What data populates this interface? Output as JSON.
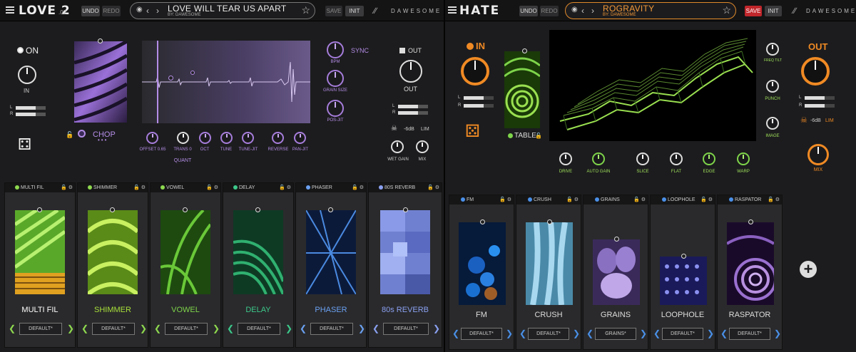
{
  "love": {
    "brand": "LOVE 2",
    "version": ".02",
    "undo": "UNDO",
    "redo": "REDO",
    "preset_name": "LOVE WILL TEAR US APART",
    "preset_by": "BY: DAWESOME",
    "save": "SAVE",
    "init": "INIT",
    "logo": "DAWESOME",
    "on_label": "ON",
    "in_label": "IN",
    "out_label": "OUT",
    "out_toggle": "OUT",
    "meter_l": "L",
    "meter_r": "R",
    "chop": "CHOP",
    "sync": "SYNC",
    "quant": "QUANT",
    "knobs": {
      "bpm": "BPM",
      "grain_size": "GRAIN SIZE",
      "pos_jit": "POS-JIT",
      "offset": "OFFSET 0.65",
      "trans": "TRANS 0",
      "oct": "OCT",
      "tune": "TUNE",
      "tune_jit": "TUNE-JIT",
      "reverse": "REVERSE",
      "pan_jit": "PAN-JIT",
      "wet_gain": "WET GAIN",
      "mix": "MIX"
    },
    "limiter": "-6dB",
    "lim": "LIM",
    "slots": [
      {
        "header": "MULTI FIL",
        "name": "MULTI FIL",
        "preset": "DEFAULT*",
        "color": "#ffffff",
        "arrow_color": "#8ed94f",
        "dot": "#8ed94f"
      },
      {
        "header": "SHIMMER",
        "name": "SHIMMER",
        "preset": "DEFAULT*",
        "color": "#a8e03a",
        "arrow_color": "#8ed94f",
        "dot": "#8ed94f"
      },
      {
        "header": "VOWEL",
        "name": "VOWEL",
        "preset": "DEFAULT*",
        "color": "#7ed44a",
        "arrow_color": "#8ed94f",
        "dot": "#8ed94f"
      },
      {
        "header": "DELAY",
        "name": "DELAY",
        "preset": "DEFAULT*",
        "color": "#3cc88a",
        "arrow_color": "#3cc88a",
        "dot": "#3cc88a"
      },
      {
        "header": "PHASER",
        "name": "PHASER",
        "preset": "DEFAULT*",
        "color": "#6aa0f0",
        "arrow_color": "#6aa0f0",
        "dot": "#6aa0f0"
      },
      {
        "header": "80S REVERB",
        "name": "80s REVERB",
        "preset": "DEFAULT*",
        "color": "#8aa0f0",
        "arrow_color": "#8aa0f0",
        "dot": "#8aa0f0"
      }
    ]
  },
  "hate": {
    "brand": "HATE",
    "undo": "UNDO",
    "redo": "REDO",
    "preset_name": "ROGRAVITY",
    "preset_by": "BY: DAWESOME",
    "save": "SAVE",
    "init": "INIT",
    "logo": "DAWESOME",
    "in_label": "IN",
    "out_label": "OUT",
    "table": "TABLE",
    "meter_l": "L",
    "meter_r": "R",
    "knobs": {
      "freq_tilt": "FREQ TILT",
      "punch": "PUNCH",
      "image": "IMAGE",
      "drive": "DRIVE",
      "auto_gain": "AUTO GAIN",
      "slice": "SLICE",
      "flat": "FLAT",
      "edge": "EDGE",
      "warp": "WARP",
      "mix": "MIX"
    },
    "limiter": "-6dB",
    "lim": "LIM",
    "add": "+",
    "slots": [
      {
        "header": "FM",
        "name": "FM",
        "preset": "DEFAULT*"
      },
      {
        "header": "CRUSH",
        "name": "CRUSH",
        "preset": "DEFAULT*"
      },
      {
        "header": "GRAINS",
        "name": "GRAINS",
        "preset": "GRAINS*"
      },
      {
        "header": "LOOPHOLE",
        "name": "LOOPHOLE",
        "preset": "DEFAULT*"
      },
      {
        "header": "RASPATOR",
        "name": "RASPATOR",
        "preset": "DEFAULT*"
      }
    ]
  },
  "colors": {
    "love_accent": "#a67ddb",
    "hate_green": "#7ed44a",
    "hate_orange": "#f08a24",
    "hate_slot_blue": "#4a90e8"
  }
}
